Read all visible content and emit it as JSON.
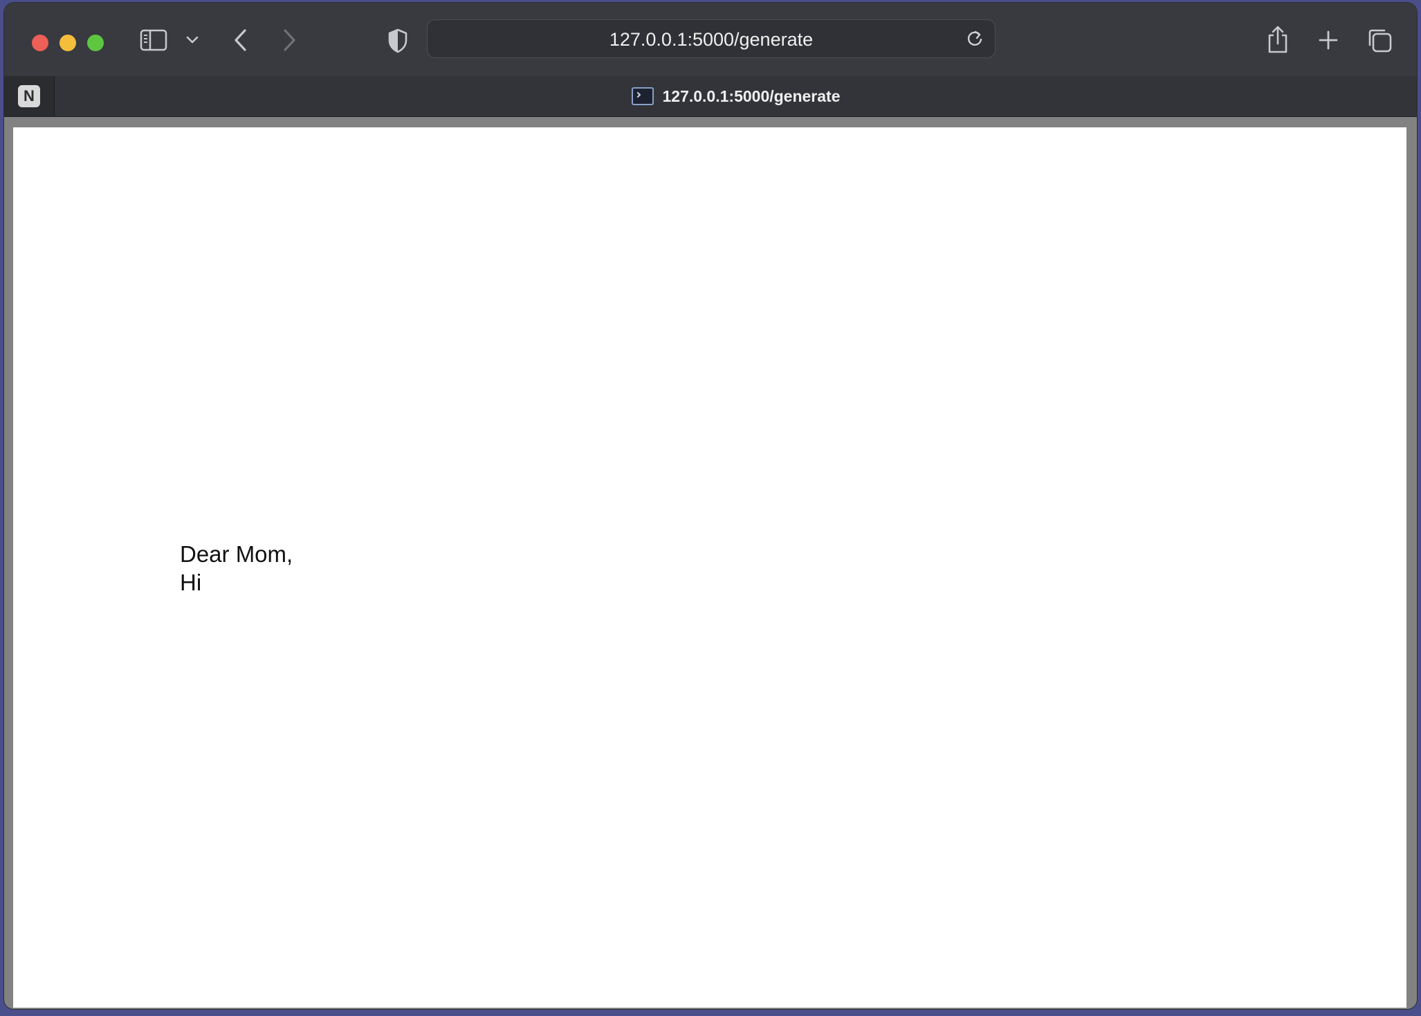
{
  "browser": {
    "address_bar": {
      "url": "127.0.0.1:5000/generate"
    },
    "tabs": [
      {
        "label": "N",
        "pinned": true
      },
      {
        "label": "127.0.0.1:5000/generate",
        "active": true
      }
    ],
    "icons": {
      "close": "close-traffic-light",
      "minimize": "minimize-traffic-light",
      "zoom": "zoom-traffic-light",
      "sidebar": "sidebar-icon",
      "sidebar_menu": "chevron-down-icon",
      "back": "back-arrow-icon",
      "forward": "forward-arrow-icon",
      "privacy": "shield-icon",
      "reload": "reload-icon",
      "share": "share-icon",
      "new_tab": "plus-icon",
      "tab_overview": "tab-overview-icon"
    },
    "colors": {
      "close": "#ed5f57",
      "minimize": "#f5bd3c",
      "zoom": "#5fc73f"
    }
  },
  "page": {
    "greeting": "Dear Mom,",
    "body": "Hi"
  }
}
